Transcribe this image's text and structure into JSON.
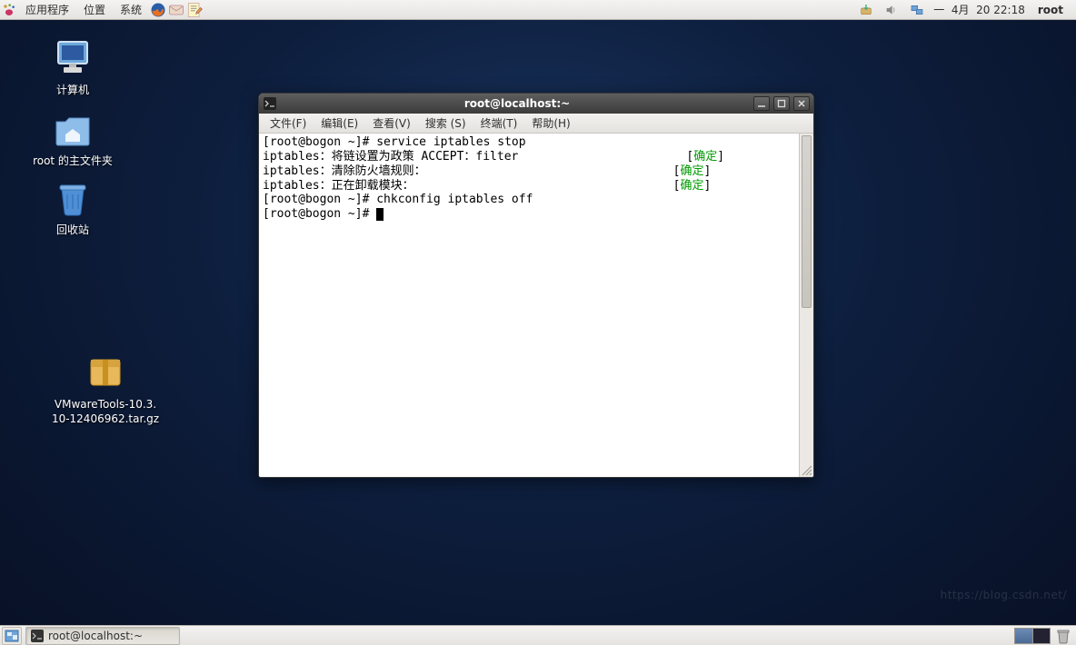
{
  "top_panel": {
    "menu": {
      "apps": "应用程序",
      "places": "位置",
      "system": "系统"
    },
    "datetime": "一  4月  20 22:18",
    "user": "root"
  },
  "desktop": {
    "computer": "计算机",
    "home": "root 的主文件夹",
    "trash": "回收站",
    "file1_line1": "VMwareTools-10.3.",
    "file1_line2": "10-12406962.tar.gz"
  },
  "terminal": {
    "title": "root@localhost:~",
    "menus": {
      "file": "文件(F)",
      "edit": "编辑(E)",
      "view": "查看(V)",
      "search": "搜索 (S)",
      "terminal": "终端(T)",
      "help": "帮助(H)"
    },
    "lines": {
      "l1": "[root@bogon ~]# service iptables stop",
      "l2a": "iptables：将链设置为政策 ACCEPT：filter",
      "l2b_pre": "[",
      "l2b_ok": "确定",
      "l2b_post": "]",
      "l3a": "iptables：清除防火墙规则：",
      "l3b_pre": "[",
      "l3b_ok": "确定",
      "l3b_post": "]",
      "l4a": "iptables：正在卸载模块：",
      "l4b_pre": "[",
      "l4b_ok": "确定",
      "l4b_post": "]",
      "l5": "[root@bogon ~]# chkconfig iptables off",
      "l6": "[root@bogon ~]# "
    }
  },
  "taskbar": {
    "task1": "root@localhost:~"
  },
  "watermark": "https://blog.csdn.net/"
}
